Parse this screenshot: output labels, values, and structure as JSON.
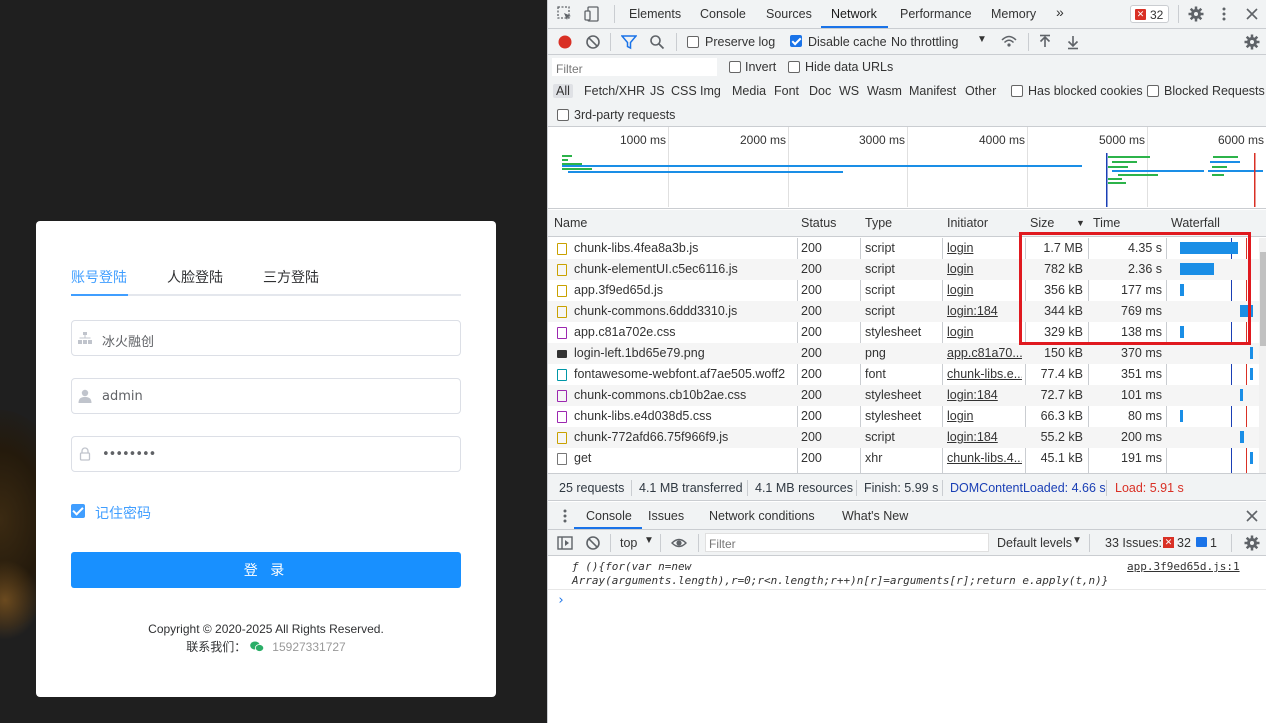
{
  "login": {
    "tabs": [
      "账号登陆",
      "人脸登陆",
      "三方登陆"
    ],
    "active_tab": 0,
    "company_value": "冰火融创",
    "username_value": "admin",
    "password_value": "••••••••",
    "remember_label": "记住密码",
    "login_button": "登 录",
    "copyright": "Copyright © 2020-2025 All Rights Reserved.",
    "contact_label": "联系我们：",
    "contact_phone": "15927331727",
    "colors": {
      "primary": "#409eff",
      "button": "#1890ff",
      "background": "#1f1f1f"
    }
  },
  "devtools": {
    "main_tabs": [
      "Elements",
      "Console",
      "Sources",
      "Network",
      "Performance",
      "Memory"
    ],
    "active_tab": "Network",
    "more_tabs_icon": "chevron-double-right-icon",
    "issues_badge": "32",
    "network_toolbar": {
      "preserve_log": "Preserve log",
      "disable_cache": "Disable cache",
      "throttling": "No throttling"
    },
    "filter_placeholder": "Filter",
    "invert_label": "Invert",
    "hide_data_urls_label": "Hide data URLs",
    "type_filters": [
      "All",
      "Fetch/XHR",
      "JS",
      "CSS",
      "Img",
      "Media",
      "Font",
      "Doc",
      "WS",
      "Wasm",
      "Manifest",
      "Other"
    ],
    "has_blocked_cookies": "Has blocked cookies",
    "blocked_requests": "Blocked Requests",
    "third_party": "3rd-party requests",
    "overview_ticks": [
      "1000 ms",
      "2000 ms",
      "3000 ms",
      "4000 ms",
      "5000 ms",
      "6000 ms"
    ],
    "columns": [
      "Name",
      "Status",
      "Type",
      "Initiator",
      "Size",
      "Time",
      "Waterfall"
    ],
    "rows": [
      {
        "name": "chunk-libs.4fea8a3b.js",
        "status": "200",
        "type": "script",
        "initiator": "login",
        "size": "1.7 MB",
        "time": "4.35 s",
        "icon": "js"
      },
      {
        "name": "chunk-elementUI.c5ec6116.js",
        "status": "200",
        "type": "script",
        "initiator": "login",
        "size": "782 kB",
        "time": "2.36 s",
        "icon": "js"
      },
      {
        "name": "app.3f9ed65d.js",
        "status": "200",
        "type": "script",
        "initiator": "login",
        "size": "356 kB",
        "time": "177 ms",
        "icon": "js"
      },
      {
        "name": "chunk-commons.6ddd3310.js",
        "status": "200",
        "type": "script",
        "initiator": "login:184",
        "size": "344 kB",
        "time": "769 ms",
        "icon": "js"
      },
      {
        "name": "app.c81a702e.css",
        "status": "200",
        "type": "stylesheet",
        "initiator": "login",
        "size": "329 kB",
        "time": "138 ms",
        "icon": "css"
      },
      {
        "name": "login-left.1bd65e79.png",
        "status": "200",
        "type": "png",
        "initiator": "app.c81a70...",
        "size": "150 kB",
        "time": "370 ms",
        "icon": "png"
      },
      {
        "name": "fontawesome-webfont.af7ae505.woff2",
        "status": "200",
        "type": "font",
        "initiator": "chunk-libs.e...",
        "size": "77.4 kB",
        "time": "351 ms",
        "icon": "font"
      },
      {
        "name": "chunk-commons.cb10b2ae.css",
        "status": "200",
        "type": "stylesheet",
        "initiator": "login:184",
        "size": "72.7 kB",
        "time": "101 ms",
        "icon": "css"
      },
      {
        "name": "chunk-libs.e4d038d5.css",
        "status": "200",
        "type": "stylesheet",
        "initiator": "login",
        "size": "66.3 kB",
        "time": "80 ms",
        "icon": "css"
      },
      {
        "name": "chunk-772afd66.75f966f9.js",
        "status": "200",
        "type": "script",
        "initiator": "login:184",
        "size": "55.2 kB",
        "time": "200 ms",
        "icon": "js"
      },
      {
        "name": "get",
        "status": "200",
        "type": "xhr",
        "initiator": "chunk-libs.4...",
        "size": "45.1 kB",
        "time": "191 ms",
        "icon": "xhr"
      }
    ],
    "summary": {
      "requests": "25 requests",
      "transferred": "4.1 MB transferred",
      "resources": "4.1 MB resources",
      "finish": "Finish: 5.99 s",
      "dom_loaded": "DOMContentLoaded: 4.66 s",
      "load": "Load: 5.91 s"
    },
    "drawer_tabs": [
      "Console",
      "Issues",
      "Network conditions",
      "What's New"
    ],
    "console_toolbar": {
      "context": "top",
      "filter_placeholder": "Filter",
      "levels": "Default levels",
      "issues_label": "33 Issues:",
      "errors": "32",
      "info": "1"
    },
    "console_lines": [
      "ƒ (){for(var n=new",
      "Array(arguments.length),r=0;r<n.length;r++)n[r]=arguments[r];return e.apply(t,n)}"
    ],
    "console_source": "app.3f9ed65d.js:1",
    "colors": {
      "accent": "#1a73e8",
      "error": "#d93025",
      "dom_blue": "#1a3fb5",
      "highlight": "#e0191f"
    }
  }
}
